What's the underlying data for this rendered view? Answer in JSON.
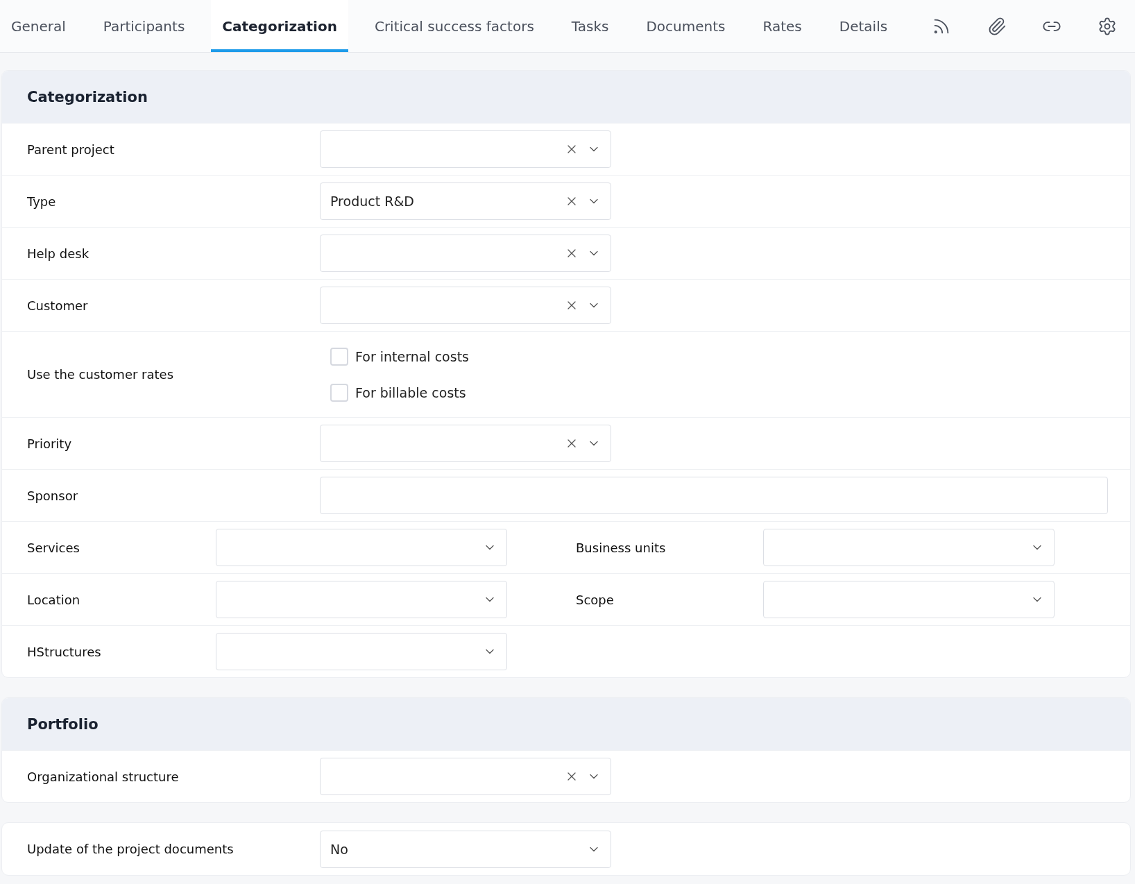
{
  "tabs": [
    {
      "label": "General",
      "selected": false
    },
    {
      "label": "Participants",
      "selected": false
    },
    {
      "label": "Categorization",
      "selected": true
    },
    {
      "label": "Critical success factors",
      "selected": false
    },
    {
      "label": "Tasks",
      "selected": false
    },
    {
      "label": "Documents",
      "selected": false
    },
    {
      "label": "Rates",
      "selected": false
    },
    {
      "label": "Details",
      "selected": false
    }
  ],
  "sections": [
    {
      "title": "Categorization",
      "rows": [
        {
          "kind": "select",
          "label": "Parent project",
          "value": "",
          "clearable": true
        },
        {
          "kind": "select",
          "label": "Type",
          "value": "Product R&D",
          "clearable": true
        },
        {
          "kind": "select",
          "label": "Help desk",
          "value": "",
          "clearable": true
        },
        {
          "kind": "select",
          "label": "Customer",
          "value": "",
          "clearable": true
        },
        {
          "kind": "checks",
          "label": "Use the customer rates",
          "options": [
            {
              "label": "For internal costs",
              "checked": false
            },
            {
              "label": "For billable costs",
              "checked": false
            }
          ]
        },
        {
          "kind": "select",
          "label": "Priority",
          "value": "",
          "clearable": true
        },
        {
          "kind": "text",
          "label": "Sponsor"
        },
        {
          "kind": "pair",
          "fields": [
            {
              "label": "Services"
            },
            {
              "label": "Business units"
            }
          ]
        },
        {
          "kind": "pair",
          "fields": [
            {
              "label": "Location"
            },
            {
              "label": "Scope"
            }
          ]
        },
        {
          "kind": "pair",
          "fields": [
            {
              "label": "HStructures"
            }
          ]
        }
      ]
    },
    {
      "title": "Portfolio",
      "rows": [
        {
          "kind": "select",
          "label": "Organizational structure",
          "value": "",
          "clearable": true
        }
      ]
    },
    {
      "rows": [
        {
          "kind": "select",
          "label": "Update of the project documents",
          "value": "No",
          "clearable": false
        }
      ]
    }
  ]
}
